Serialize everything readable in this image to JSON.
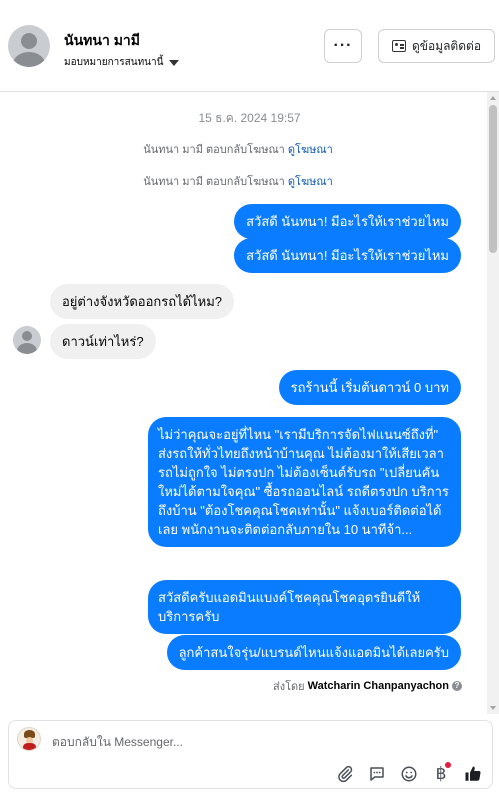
{
  "header": {
    "contact_name": "นันทนา มามี",
    "assign_label": "มอบหมายการสนทนานี้",
    "more_label": "···",
    "contact_info_label": "ดูข้อมูลติดต่อ"
  },
  "chat": {
    "timestamp": "15 ธ.ค. 2024 19:57",
    "system_lines": [
      {
        "text": "นันทนา มามี ตอบกลับโฆษณา",
        "link": "ดูโฆษณา"
      },
      {
        "text": "นันทนา มามี ตอบกลับโฆษณา",
        "link": "ดูโฆษณา"
      }
    ],
    "messages": [
      {
        "direction": "out",
        "text": "สวัสดี นันทนา! มีอะไรให้เราช่วยไหม"
      },
      {
        "direction": "out",
        "text": "สวัสดี นันทนา! มีอะไรให้เราช่วยไหม"
      },
      {
        "direction": "in",
        "text": "อยู่ต่างจังหวัดออกรถได้ไหม?"
      },
      {
        "direction": "in",
        "text": "ดาวน์เท่าไหร่?"
      },
      {
        "direction": "out",
        "text": "รถร้านนี้ เริ่มต้นดาวน์ 0 บาท"
      },
      {
        "direction": "out",
        "text": "ไม่ว่าคุณจะอยู่ที่ไหน \"เรามีบริการจัดไฟแนนซ์ถึงที่\"  ส่งรถให้ทั่วไทยถึงหน้าบ้านคุณ ไม่ต้องมาให้เสียเวลา รถไม่ถูกใจ ไม่ตรงปก ไม่ต้องเซ็นต์รับรถ \"เปลี่ยนคันใหม่ได้ตามใจคุณ\" ซื้อรถออนไลน์ รถดีตรงปก บริการถึงบ้าน \"ต้องโชคคุณโชคเท่านั้น\" แจ้งเบอร์ติดต่อได้เลย พนักงานจะติดต่อกลับภายใน 10 นาทีจ้า..."
      },
      {
        "direction": "out",
        "text": "สวัสดีครับแอดมินแบงค์โชคคุณโชคอุดรยินดีให้บริการครับ"
      },
      {
        "direction": "out",
        "text": "ลูกค้าสนใจรุ่น/แบรนด์ไหนแจ้งแอดมินได้เลยครับ"
      }
    ],
    "sent_by_prefix": "ส่งโดย",
    "sent_by_name": "Watcharin Chanpanyachon",
    "help_glyph": "?"
  },
  "composer": {
    "placeholder": "ตอบกลับใน Messenger...",
    "tools": [
      "paperclip-icon",
      "saved-reply-icon",
      "emoji-icon",
      "baht-icon",
      "thumbs-up-icon"
    ],
    "baht_glyph": "฿",
    "accent_color": "#0a7cff",
    "notification_color": "#e41e3f"
  }
}
